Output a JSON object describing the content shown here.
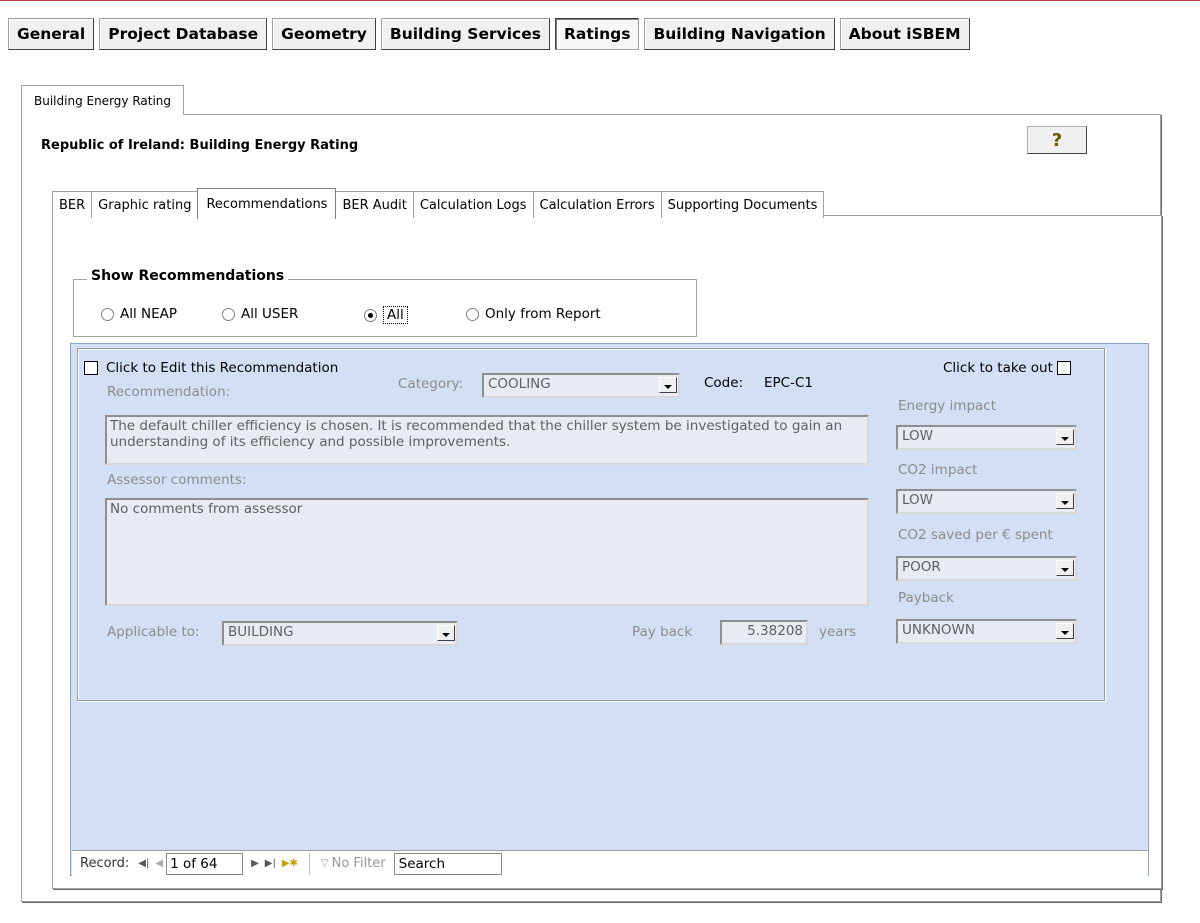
{
  "menu": [
    "General",
    "Project Database",
    "Geometry",
    "Building Services",
    "Ratings",
    "Building Navigation",
    "About iSBEM"
  ],
  "outer_tab": "Building Energy Rating",
  "page_title": "Republic of Ireland: Building Energy Rating",
  "help_glyph": "?",
  "inner_tabs": [
    "BER",
    "Graphic rating",
    "Recommendations",
    "BER Audit",
    "Calculation Logs",
    "Calculation Errors",
    "Supporting Documents"
  ],
  "show_recs": {
    "label": "Show Recommendations",
    "options": [
      "All NEAP",
      "All USER",
      "All",
      "Only from Report"
    ],
    "selected": "All"
  },
  "rec": {
    "edit_label": "Click to Edit this Recommendation",
    "takeout_label": "Click to take out",
    "recommendation_label": "Recommendation:",
    "category_label": "Category:",
    "category_value": "COOLING",
    "code_label": "Code:",
    "code_value": "EPC-C1",
    "recommendation_text": "The default chiller efficiency is chosen. It is recommended that the chiller system be investigated to gain an understanding of its efficiency and possible improvements.",
    "assessor_label": "Assessor comments:",
    "assessor_text": "No comments from assessor",
    "applicable_label": "Applicable to:",
    "applicable_value": "BUILDING",
    "payback_label": "Pay back",
    "payback_value": "5.38208",
    "payback_unit": "years",
    "energy_impact_label": "Energy impact",
    "energy_impact_value": "LOW",
    "co2_impact_label": "CO2 impact",
    "co2_impact_value": "LOW",
    "co2_saved_label": "CO2 saved per € spent",
    "co2_saved_value": "POOR",
    "payback_cat_label": "Payback",
    "payback_cat_value": "UNKNOWN"
  },
  "record_nav": {
    "label": "Record:",
    "current": "1 of 64",
    "filter": "No Filter",
    "search": "Search"
  },
  "colors": {
    "subform_bg": "#d2dff4",
    "field_bg": "#e7ebf2"
  }
}
